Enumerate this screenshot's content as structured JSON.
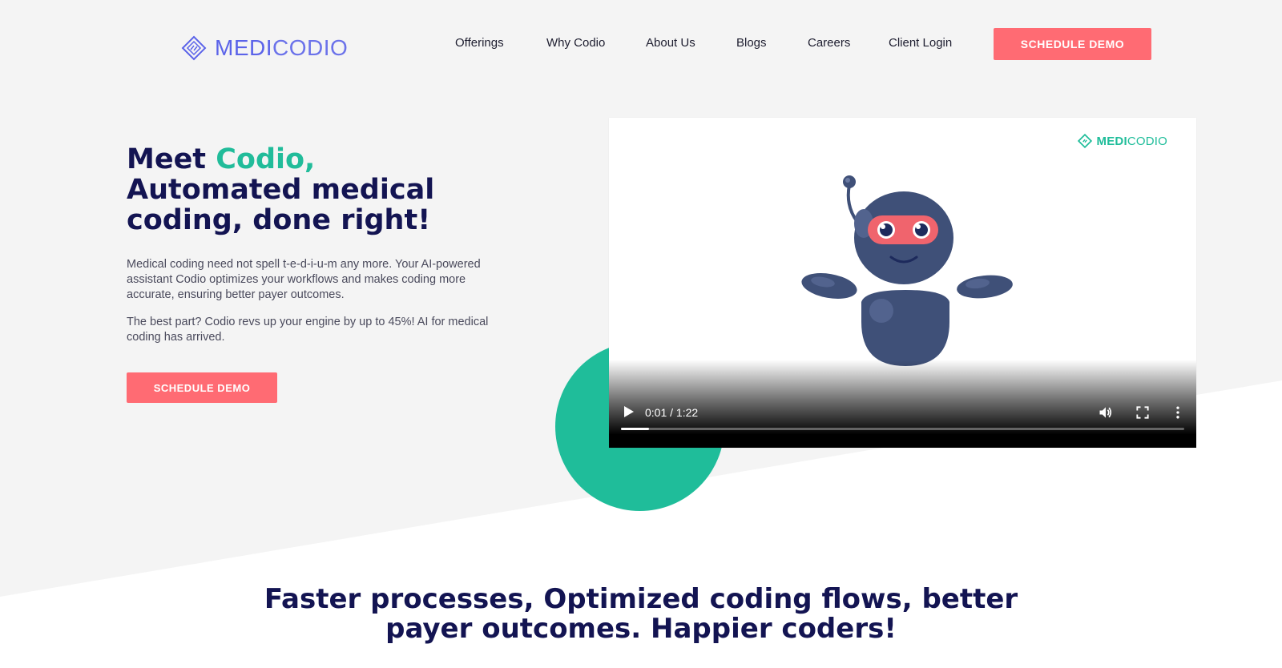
{
  "header": {
    "brand_part1": "MEDI",
    "brand_part2": "CODIO",
    "nav": [
      {
        "label": "Offerings"
      },
      {
        "label": "Why Codio"
      },
      {
        "label": "About Us"
      },
      {
        "label": "Blogs"
      },
      {
        "label": "Careers"
      },
      {
        "label": "Client Login"
      }
    ],
    "cta_label": "SCHEDULE DEMO"
  },
  "hero": {
    "title_meet": "Meet ",
    "title_accent": "Codio,",
    "title_line2": "Automated medical",
    "title_line3": "coding, done right!",
    "paragraph1": "Medical coding need not spell t-e-d-i-u-m any more. Your AI-powered assistant Codio optimizes your workflows and makes coding more accurate, ensuring better payer outcomes.",
    "paragraph2": "The best part? Codio revs up your engine by up to 45%! AI for medical coding has arrived.",
    "cta_label": "SCHEDULE DEMO"
  },
  "video": {
    "logo_part1": "MEDI",
    "logo_part2": "CODIO",
    "time_display": "0:01 / 1:22",
    "progress_fraction": 0.05,
    "icons": [
      "play-icon",
      "volume-icon",
      "fullscreen-icon",
      "more-options-icon"
    ]
  },
  "tagline": {
    "line1": "Faster processes, Optimized coding flows, better",
    "line2": "payer outcomes. Happier coders!"
  },
  "colors": {
    "navy": "#131452",
    "teal": "#1fbd9a",
    "coral": "#ff6b73",
    "brand_blue": "#5b63e9",
    "bg_gray": "#f4f4f4"
  }
}
